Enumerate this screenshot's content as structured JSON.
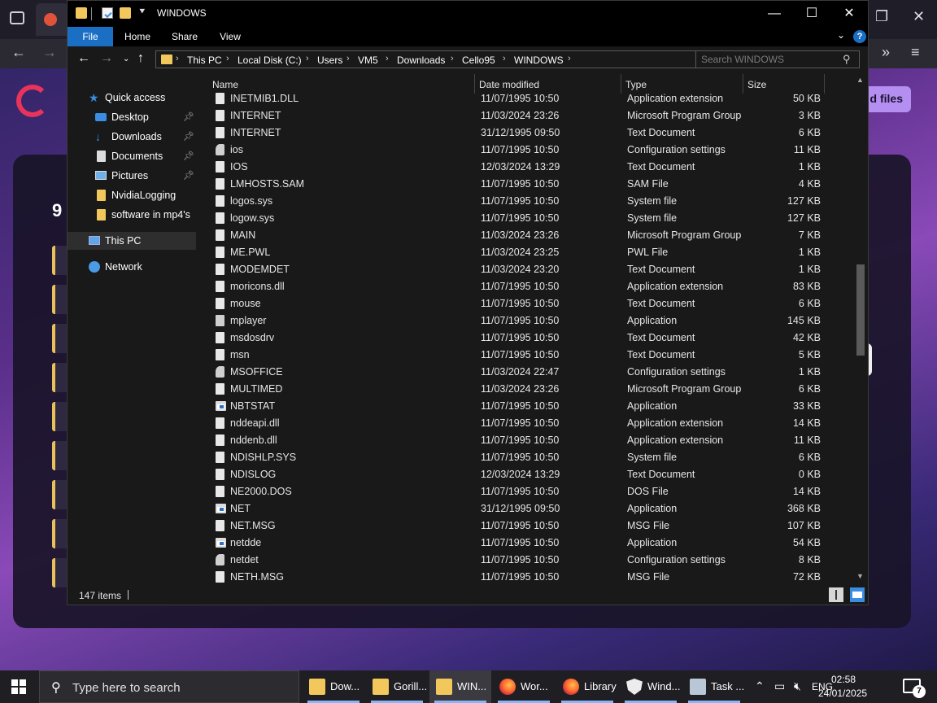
{
  "window": {
    "title": "WINDOWS",
    "minimize_glyph": "—",
    "maximize_glyph": "☐",
    "close_glyph": "✕"
  },
  "ribbon": {
    "tabs": [
      "File",
      "Home",
      "Share",
      "View"
    ],
    "help": "?"
  },
  "address": {
    "crumbs": [
      "This PC",
      "Local Disk (C:)",
      "Users",
      "VM5",
      "Downloads",
      "Cello95",
      "WINDOWS"
    ],
    "search_placeholder": "Search WINDOWS"
  },
  "nav_pane": {
    "items": [
      {
        "label": "Quick access",
        "icon": "star-icon"
      },
      {
        "label": "Desktop",
        "icon": "desktop-icon",
        "pinned": true
      },
      {
        "label": "Downloads",
        "icon": "download-icon",
        "pinned": true
      },
      {
        "label": "Documents",
        "icon": "document-icon",
        "pinned": true
      },
      {
        "label": "Pictures",
        "icon": "pictures-icon",
        "pinned": true
      },
      {
        "label": "NvidiaLogging",
        "icon": "folder-icon"
      },
      {
        "label": "software in mp4's",
        "icon": "folder-icon"
      },
      {
        "label": "This PC",
        "icon": "computer-icon",
        "selected": true
      },
      {
        "label": "Network",
        "icon": "network-icon"
      }
    ]
  },
  "columns": {
    "name": "Name",
    "date": "Date modified",
    "type": "Type",
    "size": "Size"
  },
  "files": [
    {
      "name": "INETMIB1.DLL",
      "date": "11/07/1995 10:50",
      "type": "Application extension",
      "size": "50 KB",
      "icon": "doc"
    },
    {
      "name": "INTERNET",
      "date": "11/03/2024 23:26",
      "type": "Microsoft Program Group",
      "size": "3 KB",
      "icon": "doc"
    },
    {
      "name": "INTERNET",
      "date": "31/12/1995 09:50",
      "type": "Text Document",
      "size": "6 KB",
      "icon": "doc"
    },
    {
      "name": "ios",
      "date": "11/07/1995 10:50",
      "type": "Configuration settings",
      "size": "11 KB",
      "icon": "cfg"
    },
    {
      "name": "IOS",
      "date": "12/03/2024 13:29",
      "type": "Text Document",
      "size": "1 KB",
      "icon": "doc"
    },
    {
      "name": "LMHOSTS.SAM",
      "date": "11/07/1995 10:50",
      "type": "SAM File",
      "size": "4 KB",
      "icon": "doc"
    },
    {
      "name": "logos.sys",
      "date": "11/07/1995 10:50",
      "type": "System file",
      "size": "127 KB",
      "icon": "doc"
    },
    {
      "name": "logow.sys",
      "date": "11/07/1995 10:50",
      "type": "System file",
      "size": "127 KB",
      "icon": "doc"
    },
    {
      "name": "MAIN",
      "date": "11/03/2024 23:26",
      "type": "Microsoft Program Group",
      "size": "7 KB",
      "icon": "doc"
    },
    {
      "name": "ME.PWL",
      "date": "11/03/2024 23:25",
      "type": "PWL File",
      "size": "1 KB",
      "icon": "doc"
    },
    {
      "name": "MODEMDET",
      "date": "11/03/2024 23:20",
      "type": "Text Document",
      "size": "1 KB",
      "icon": "doc"
    },
    {
      "name": "moricons.dll",
      "date": "11/07/1995 10:50",
      "type": "Application extension",
      "size": "83 KB",
      "icon": "doc"
    },
    {
      "name": "mouse",
      "date": "11/07/1995 10:50",
      "type": "Text Document",
      "size": "6 KB",
      "icon": "doc"
    },
    {
      "name": "mplayer",
      "date": "11/07/1995 10:50",
      "type": "Application",
      "size": "145 KB",
      "icon": "mp"
    },
    {
      "name": "msdosdrv",
      "date": "11/07/1995 10:50",
      "type": "Text Document",
      "size": "42 KB",
      "icon": "doc"
    },
    {
      "name": "msn",
      "date": "11/07/1995 10:50",
      "type": "Text Document",
      "size": "5 KB",
      "icon": "doc"
    },
    {
      "name": "MSOFFICE",
      "date": "11/03/2024 22:47",
      "type": "Configuration settings",
      "size": "1 KB",
      "icon": "cfg"
    },
    {
      "name": "MULTIMED",
      "date": "11/03/2024 23:26",
      "type": "Microsoft Program Group",
      "size": "6 KB",
      "icon": "doc"
    },
    {
      "name": "NBTSTAT",
      "date": "11/07/1995 10:50",
      "type": "Application",
      "size": "33 KB",
      "icon": "app"
    },
    {
      "name": "nddeapi.dll",
      "date": "11/07/1995 10:50",
      "type": "Application extension",
      "size": "14 KB",
      "icon": "doc"
    },
    {
      "name": "nddenb.dll",
      "date": "11/07/1995 10:50",
      "type": "Application extension",
      "size": "11 KB",
      "icon": "doc"
    },
    {
      "name": "NDISHLP.SYS",
      "date": "11/07/1995 10:50",
      "type": "System file",
      "size": "6 KB",
      "icon": "doc"
    },
    {
      "name": "NDISLOG",
      "date": "12/03/2024 13:29",
      "type": "Text Document",
      "size": "0 KB",
      "icon": "doc"
    },
    {
      "name": "NE2000.DOS",
      "date": "11/07/1995 10:50",
      "type": "DOS File",
      "size": "14 KB",
      "icon": "doc"
    },
    {
      "name": "NET",
      "date": "31/12/1995 09:50",
      "type": "Application",
      "size": "368 KB",
      "icon": "app"
    },
    {
      "name": "NET.MSG",
      "date": "11/07/1995 10:50",
      "type": "MSG File",
      "size": "107 KB",
      "icon": "doc"
    },
    {
      "name": "netdde",
      "date": "11/07/1995 10:50",
      "type": "Application",
      "size": "54 KB",
      "icon": "app"
    },
    {
      "name": "netdet",
      "date": "11/07/1995 10:50",
      "type": "Configuration settings",
      "size": "8 KB",
      "icon": "cfg"
    },
    {
      "name": "NETH.MSG",
      "date": "11/07/1995 10:50",
      "type": "MSG File",
      "size": "72 KB",
      "icon": "doc"
    }
  ],
  "status": {
    "item_count": "147 items"
  },
  "background_page": {
    "add_files_text": "d files",
    "page_number": "9"
  },
  "taskbar": {
    "search_placeholder": "Type here to search",
    "apps": [
      {
        "label": "Dow...",
        "icon": "folder-icon"
      },
      {
        "label": "Gorill...",
        "icon": "folder-icon"
      },
      {
        "label": "WIN...",
        "icon": "folder-icon",
        "active": true
      },
      {
        "label": "Wor...",
        "icon": "firefox-icon"
      },
      {
        "label": "Library",
        "icon": "firefox-icon"
      },
      {
        "label": "Wind...",
        "icon": "shield-icon"
      },
      {
        "label": "Task ...",
        "icon": "task-manager-icon"
      }
    ],
    "language": "ENG",
    "time": "02:58",
    "date": "24/01/2025",
    "notification_count": "7"
  },
  "colors": {
    "accent": "#1a6fc4",
    "window_bg": "#191919",
    "folder": "#f2c75c"
  }
}
